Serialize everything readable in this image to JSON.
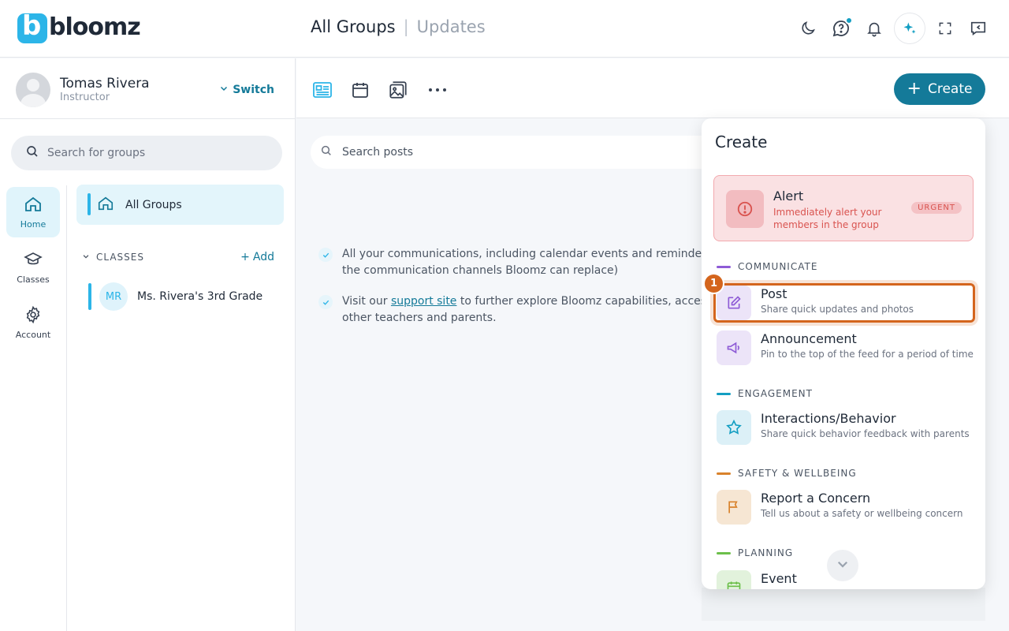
{
  "header": {
    "logo_text": "bloomz",
    "breadcrumb_main": "All Groups",
    "breadcrumb_sep": "|",
    "breadcrumb_sub": "Updates",
    "icons": [
      "moon-icon",
      "help-chat-icon",
      "bell-icon",
      "sparkle-icon",
      "fullscreen-icon",
      "feedback-icon"
    ]
  },
  "profile": {
    "name": "Tomas Rivera",
    "role": "Instructor",
    "switch_label": "Switch"
  },
  "groups_search": {
    "placeholder": "Search for groups"
  },
  "nav": [
    {
      "label": "Home",
      "icon": "home-icon",
      "active": true
    },
    {
      "label": "Classes",
      "icon": "graduation-cap-icon",
      "active": false
    },
    {
      "label": "Account",
      "icon": "gear-icon",
      "active": false
    }
  ],
  "groups": {
    "all_groups": "All Groups",
    "classes_header": "CLASSES",
    "add_label": "Add",
    "classes": [
      {
        "initials": "MR",
        "name": "Ms. Rivera's 3rd Grade"
      }
    ]
  },
  "toolbar": {
    "icons": [
      "feed-icon",
      "calendar-icon",
      "gallery-icon",
      "more-icon"
    ],
    "create_label": "Create"
  },
  "posts_search": {
    "placeholder": "Search posts"
  },
  "tips": [
    {
      "text": "All your communications, including calendar events and reminders ac",
      "text2": "the communication channels Bloomz can replace)"
    },
    {
      "pre": "Visit our ",
      "link": "support site",
      "post": " to further explore Bloomz capabilities, access ho",
      "text2": "other teachers and parents."
    }
  ],
  "create_menu": {
    "title": "Create",
    "alert": {
      "title": "Alert",
      "desc": "Immediately alert your members in the group",
      "badge": "URGENT"
    },
    "sections": [
      {
        "name": "COMMUNICATE",
        "color": "#8e5bd6"
      },
      {
        "name": "ENGAGEMENT",
        "color": "#139ec2"
      },
      {
        "name": "SAFETY & WELLBEING",
        "color": "#d9822b"
      },
      {
        "name": "PLANNING",
        "color": "#6cbf4a"
      }
    ],
    "items": [
      {
        "title": "Post",
        "desc": "Share quick updates and photos"
      },
      {
        "title": "Announcement",
        "desc": "Pin to the top of the feed for a period of time"
      },
      {
        "title": "Interactions/Behavior",
        "desc": "Share quick behavior feedback with parents"
      },
      {
        "title": "Report a Concern",
        "desc": "Tell us about a safety or wellbeing concern"
      },
      {
        "title": "Event",
        "desc": ""
      }
    ],
    "step_number": "1"
  }
}
